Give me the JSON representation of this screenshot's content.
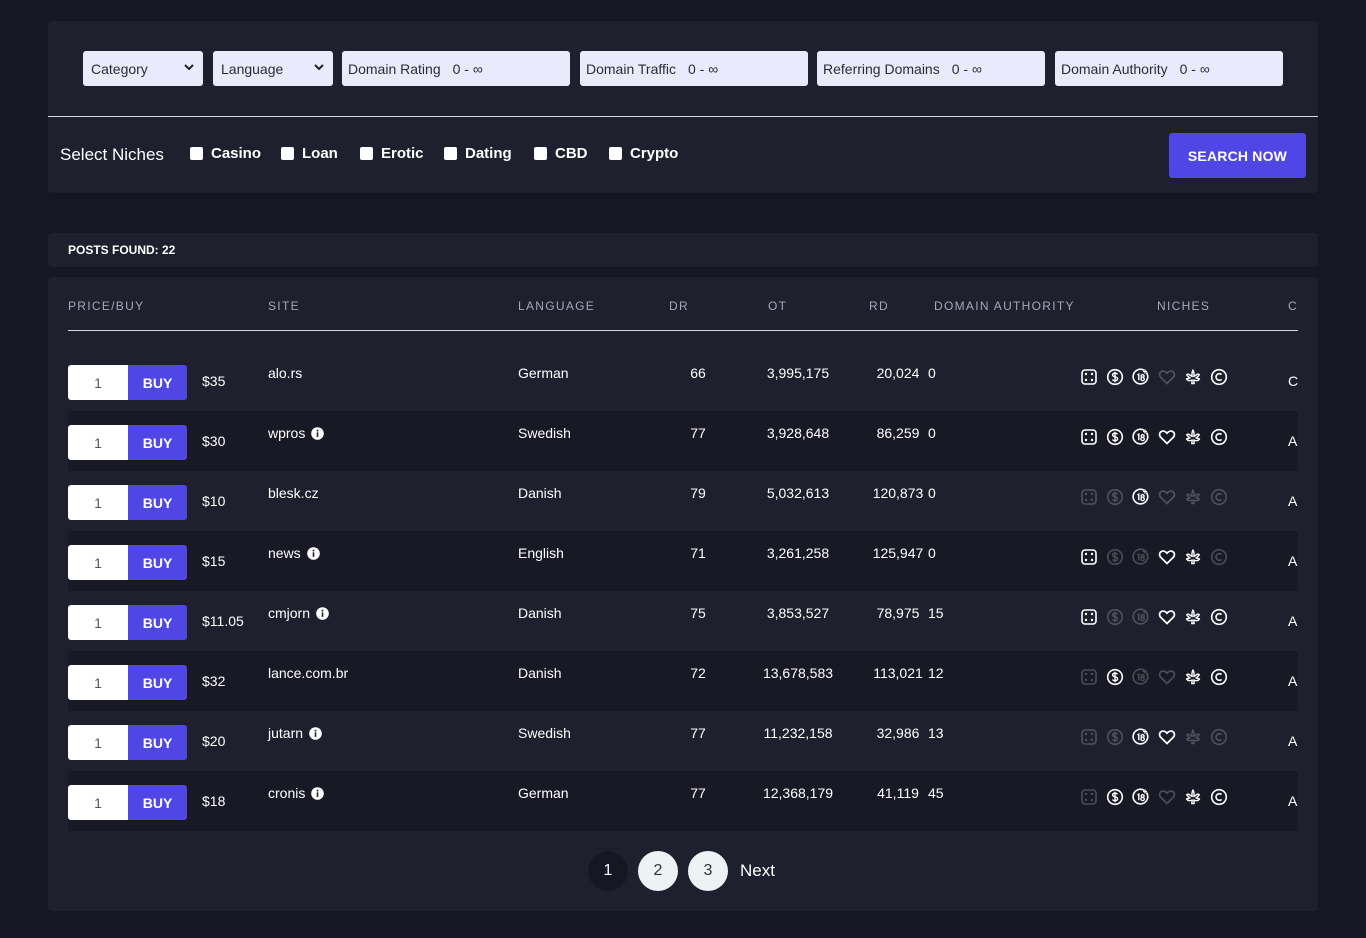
{
  "filters": {
    "category": "Category",
    "language": "Language",
    "domain_rating": {
      "label": "Domain Rating",
      "range": "0 - ∞"
    },
    "domain_traffic": {
      "label": "Domain Traffic",
      "range": "0 - ∞"
    },
    "referring_domains": {
      "label": "Referring Domains",
      "range": "0 - ∞"
    },
    "domain_authority": {
      "label": "Domain Authority",
      "range": "0 - ∞"
    }
  },
  "niches": {
    "label": "Select Niches",
    "options": [
      "Casino",
      "Loan",
      "Erotic",
      "Dating",
      "CBD",
      "Crypto"
    ]
  },
  "search_button": "SEARCH NOW",
  "posts_found": "POSTS FOUND: 22",
  "table": {
    "headers": [
      "PRICE/BUY",
      "SITE",
      "LANGUAGE",
      "DR",
      "OT",
      "RD",
      "DOMAIN AUTHORITY",
      "NICHES",
      "C"
    ],
    "buy_label": "BUY",
    "rows": [
      {
        "qty": "1",
        "price": "$35",
        "site": "alo.rs",
        "info": false,
        "language": "German",
        "dr": "66",
        "ot": "3,995,175",
        "rd": "20,024",
        "da": "0",
        "niches": [
          1,
          1,
          1,
          0,
          1,
          1
        ],
        "last": "C"
      },
      {
        "qty": "1",
        "price": "$30",
        "site": "wpros",
        "info": true,
        "language": "Swedish",
        "dr": "77",
        "ot": "3,928,648",
        "rd": "86,259",
        "da": "0",
        "niches": [
          1,
          1,
          1,
          1,
          1,
          1
        ],
        "last": "A"
      },
      {
        "qty": "1",
        "price": "$10",
        "site": "blesk.cz",
        "info": false,
        "language": "Danish",
        "dr": "79",
        "ot": "5,032,613",
        "rd": "120,873",
        "da": "0",
        "niches": [
          0,
          0,
          1,
          0,
          0,
          0
        ],
        "last": "A"
      },
      {
        "qty": "1",
        "price": "$15",
        "site": "news",
        "info": true,
        "language": "English",
        "dr": "71",
        "ot": "3,261,258",
        "rd": "125,947",
        "da": "0",
        "niches": [
          1,
          0,
          0,
          1,
          1,
          0
        ],
        "last": "A"
      },
      {
        "qty": "1",
        "price": "$11.05",
        "site": "cmjorn",
        "info": true,
        "language": "Danish",
        "dr": "75",
        "ot": "3,853,527",
        "rd": "78,975",
        "da": "15",
        "niches": [
          1,
          0,
          0,
          1,
          1,
          1
        ],
        "last": "A"
      },
      {
        "qty": "1",
        "price": "$32",
        "site": "lance.com.br",
        "info": false,
        "language": "Danish",
        "dr": "72",
        "ot": "13,678,583",
        "rd": "113,021",
        "da": "12",
        "niches": [
          0,
          1,
          0,
          0,
          1,
          1
        ],
        "last": "A"
      },
      {
        "qty": "1",
        "price": "$20",
        "site": "jutarn",
        "info": true,
        "language": "Swedish",
        "dr": "77",
        "ot": "11,232,158",
        "rd": "32,986",
        "da": "13",
        "niches": [
          0,
          0,
          1,
          1,
          0,
          0
        ],
        "last": "A"
      },
      {
        "qty": "1",
        "price": "$18",
        "site": "cronis",
        "info": true,
        "language": "German",
        "dr": "77",
        "ot": "12,368,179",
        "rd": "41,119",
        "da": "45",
        "niches": [
          0,
          1,
          1,
          0,
          1,
          1
        ],
        "last": "A"
      }
    ]
  },
  "niche_icons": [
    "dice-icon",
    "dollar-icon",
    "age-18-icon",
    "heart-icon",
    "cannabis-leaf-icon",
    "copyright-icon"
  ],
  "pagination": {
    "pages": [
      "1",
      "2",
      "3"
    ],
    "current": "1",
    "next": "Next"
  },
  "colors": {
    "accent": "#4f46e5",
    "background": "#161722",
    "panel": "#1f202e"
  }
}
